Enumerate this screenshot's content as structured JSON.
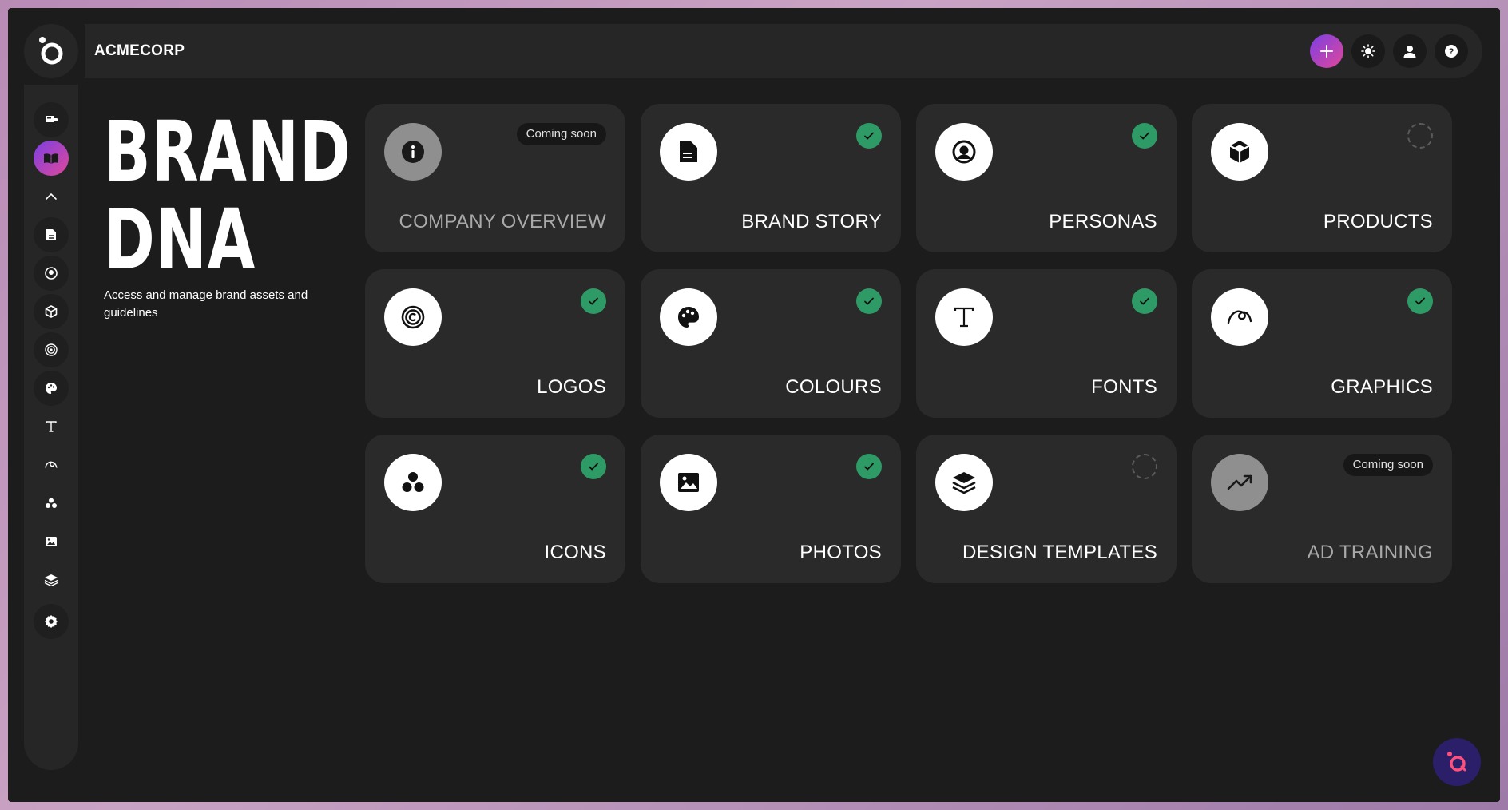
{
  "header": {
    "org_name": "ACMECORP",
    "actions": [
      "plus-icon",
      "sun-icon",
      "user-icon",
      "help-icon"
    ]
  },
  "sidebar": {
    "items": [
      {
        "icon": "hand-card-icon"
      },
      {
        "icon": "open-book-icon",
        "active": true
      },
      {
        "icon": "chevron-up-icon"
      },
      {
        "icon": "document-icon"
      },
      {
        "icon": "user-circle-icon"
      },
      {
        "icon": "cube-icon"
      },
      {
        "icon": "target-icon"
      },
      {
        "icon": "palette-icon"
      },
      {
        "icon": "text-icon"
      },
      {
        "icon": "scribble-icon"
      },
      {
        "icon": "three-dots-icon"
      },
      {
        "icon": "image-icon"
      },
      {
        "icon": "layers-icon"
      },
      {
        "icon": "settings-icon"
      }
    ]
  },
  "hero": {
    "title_line1": "BRAND",
    "title_line2": "DNA",
    "subtitle": "Access and manage brand assets and guidelines"
  },
  "cards": [
    {
      "label": "COMPANY OVERVIEW",
      "icon": "info-icon",
      "status": "Coming soon"
    },
    {
      "label": "BRAND STORY",
      "icon": "document-icon",
      "status": "complete"
    },
    {
      "label": "PERSONAS",
      "icon": "user-circle-icon",
      "status": "complete"
    },
    {
      "label": "PRODUCTS",
      "icon": "cube-icon",
      "status": "pending"
    },
    {
      "label": "LOGOS",
      "icon": "copyright-target-icon",
      "status": "complete"
    },
    {
      "label": "COLOURS",
      "icon": "palette-icon",
      "status": "complete"
    },
    {
      "label": "FONTS",
      "icon": "text-icon",
      "status": "complete"
    },
    {
      "label": "GRAPHICS",
      "icon": "scribble-icon",
      "status": "complete"
    },
    {
      "label": "ICONS",
      "icon": "three-dots-icon",
      "status": "complete"
    },
    {
      "label": "PHOTOS",
      "icon": "image-icon",
      "status": "complete"
    },
    {
      "label": "DESIGN TEMPLATES",
      "icon": "layers-icon",
      "status": "pending"
    },
    {
      "label": "AD TRAINING",
      "icon": "trend-up-icon",
      "status": "Coming soon"
    }
  ],
  "colors": {
    "accent_start": "#7b3fe4",
    "accent_end": "#e0489a",
    "check": "#2e9a66",
    "background": "#1c1c1c",
    "card": "#2a2a2a"
  }
}
